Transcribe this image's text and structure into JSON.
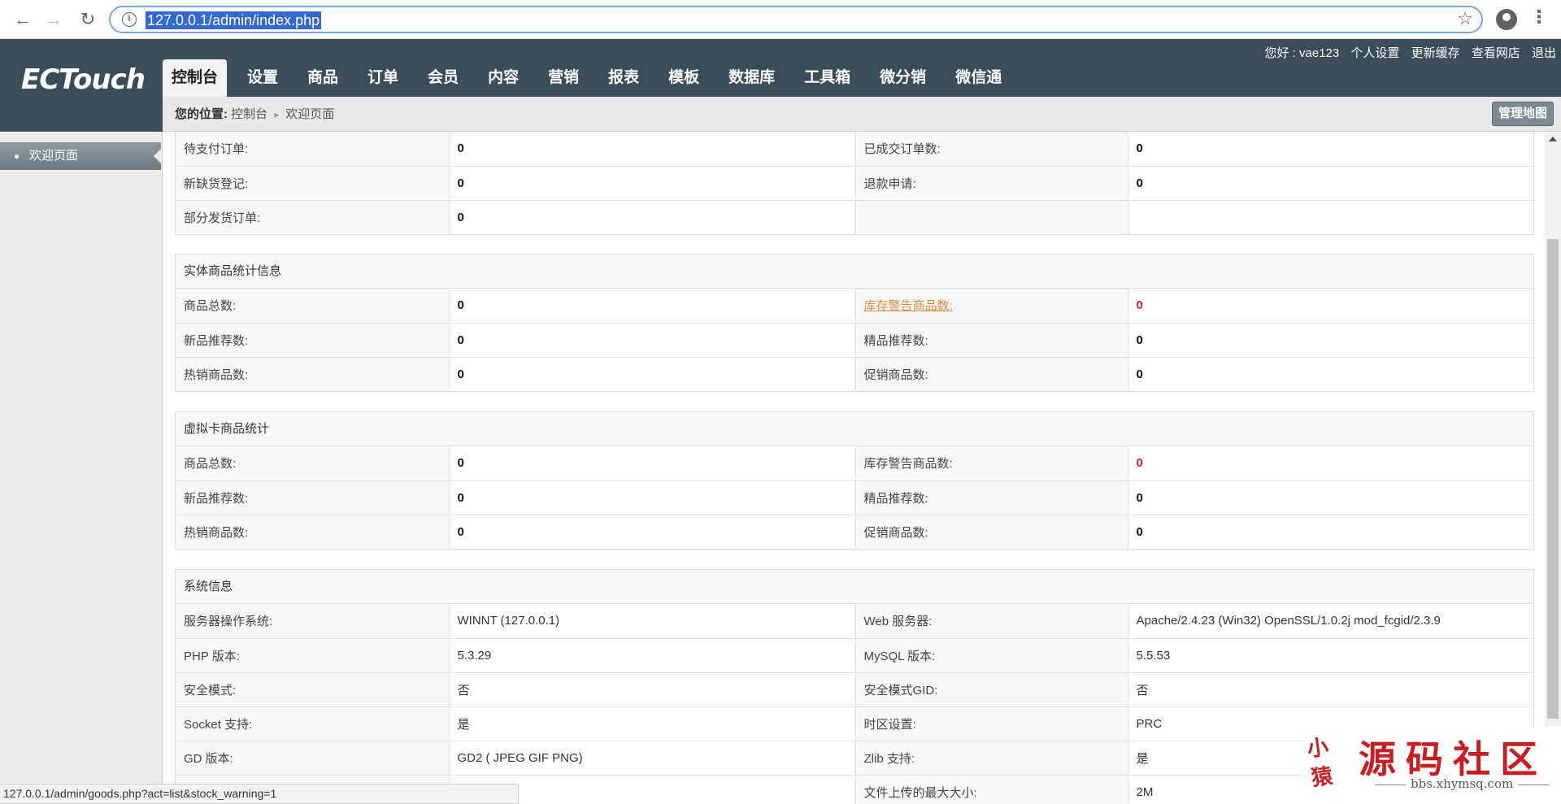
{
  "browser": {
    "url": "127.0.0.1/admin/index.php",
    "status_url": "127.0.0.1/admin/goods.php?act=list&stock_warning=1"
  },
  "header": {
    "logo": "ECTouch",
    "greeting": "您好 : vae123",
    "links": [
      "个人设置",
      "更新缓存",
      "查看网店",
      "退出"
    ],
    "nav": [
      "控制台",
      "设置",
      "商品",
      "订单",
      "会员",
      "内容",
      "营销",
      "报表",
      "模板",
      "数据库",
      "工具箱",
      "微分销",
      "微信通"
    ],
    "active_nav": "控制台"
  },
  "breadcrumb": {
    "prefix": "您的位置:",
    "parent": "控制台",
    "current": "欢迎页面",
    "map_button": "管理地图"
  },
  "sidebar": {
    "items": [
      {
        "label": "欢迎页面",
        "active": true
      }
    ]
  },
  "orders": {
    "rows": [
      [
        "待支付订单:",
        "0",
        "已成交订单数:",
        "0"
      ],
      [
        "新缺货登记:",
        "0",
        "退款申请:",
        "0"
      ],
      [
        "部分发货订单:",
        "0",
        "",
        ""
      ]
    ]
  },
  "physical_goods": {
    "title": "实体商品统计信息",
    "rows": [
      [
        "商品总数:",
        "0",
        "库存警告商品数:",
        "0"
      ],
      [
        "新品推荐数:",
        "0",
        "精品推荐数:",
        "0"
      ],
      [
        "热销商品数:",
        "0",
        "促销商品数:",
        "0"
      ]
    ]
  },
  "virtual_goods": {
    "title": "虚拟卡商品统计",
    "rows": [
      [
        "商品总数:",
        "0",
        "库存警告商品数:",
        "0"
      ],
      [
        "新品推荐数:",
        "0",
        "精品推荐数:",
        "0"
      ],
      [
        "热销商品数:",
        "0",
        "促销商品数:",
        "0"
      ]
    ]
  },
  "system_info": {
    "title": "系统信息",
    "rows": [
      [
        "服务器操作系统:",
        "WINNT (127.0.0.1)",
        "Web 服务器:",
        "Apache/2.4.23 (Win32) OpenSSL/1.0.2j mod_fcgid/2.3.9"
      ],
      [
        "PHP 版本:",
        "5.3.29",
        "MySQL 版本:",
        "5.5.53"
      ],
      [
        "安全模式:",
        "否",
        "安全模式GID:",
        "否"
      ],
      [
        "Socket 支持:",
        "是",
        "时区设置:",
        "PRC"
      ],
      [
        "GD 版本:",
        "GD2 ( JPEG GIF PNG)",
        "Zlib 支持:",
        "是"
      ],
      [
        "",
        "",
        "文件上传的最大大小:",
        "2M"
      ]
    ]
  },
  "watermark": {
    "seal": "小猿",
    "title": "源码社区",
    "url": "bbs.xhymsq.com"
  },
  "colors": {
    "header_bg": "#394c57",
    "warning_red": "#d9261c",
    "link_orange": "#e08a3c",
    "watermark_red": "#c71d23"
  }
}
